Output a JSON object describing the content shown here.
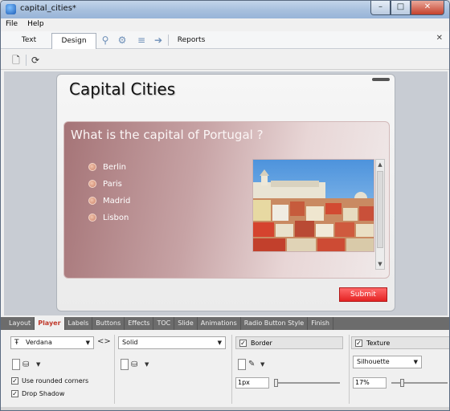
{
  "window": {
    "title": "capital_cities*",
    "controls": {
      "minimize": "–",
      "maximize": "□",
      "close": "✕"
    }
  },
  "menu": {
    "file": "File",
    "help": "Help"
  },
  "top_tabs": {
    "text": "Text",
    "design": "Design",
    "reports": "Reports",
    "close": "✕"
  },
  "slide": {
    "title": "Capital Cities",
    "question": "What is the capital of Portugal ?",
    "options": [
      "Berlin",
      "Paris",
      "Madrid",
      "Lisbon"
    ],
    "submit": "Submit"
  },
  "property_tabs": [
    "Layout",
    "Player",
    "Labels",
    "Buttons",
    "Effects",
    "TOC",
    "Slide",
    "Animations",
    "Radio Button Style",
    "Finish"
  ],
  "active_property_tab": "Player",
  "props": {
    "font": "Verdana",
    "rounded_corners": "Use rounded corners",
    "rounded_checked": true,
    "drop_shadow": "Drop Shadow",
    "shadow_checked": true,
    "fill_style": "Solid",
    "border_label": "Border",
    "border_checked": true,
    "border_width": "1px",
    "border_slider": 0.0,
    "texture_label": "Texture",
    "texture_checked": true,
    "texture_name": "Silhouette",
    "texture_opacity": "17%",
    "texture_slider": 0.17
  },
  "colors": {
    "submit": "#e42323",
    "active_tab": "#c0392b",
    "panel": "#a57477"
  }
}
